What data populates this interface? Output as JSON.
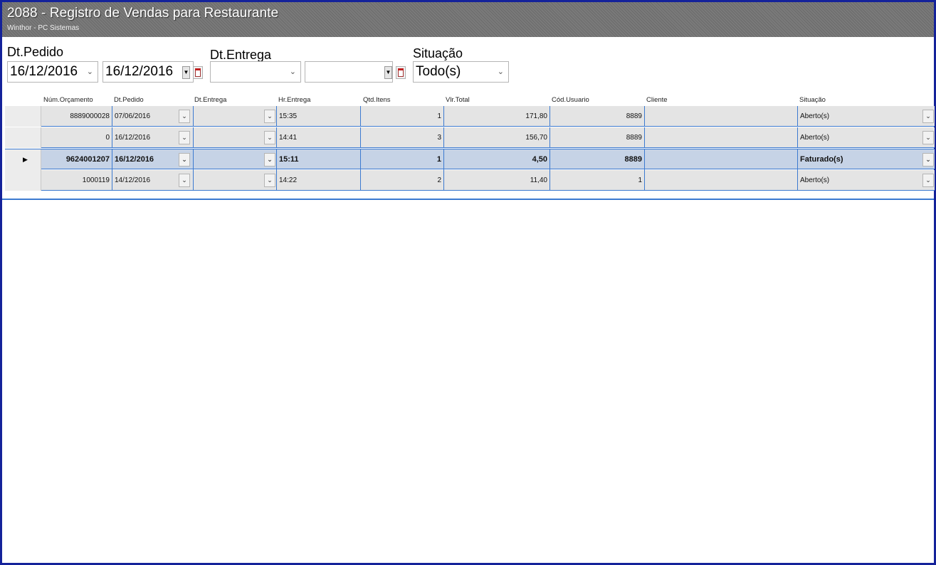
{
  "window": {
    "title": "2088 - Registro de Vendas para Restaurante",
    "subtitle": "Winthor - PC Sistemas"
  },
  "filters": {
    "dt_pedido_label": "Dt.Pedido",
    "dt_pedido_from": "16/12/2016",
    "dt_pedido_to": "16/12/2016",
    "dt_entrega_label": "Dt.Entrega",
    "dt_entrega_from": "",
    "dt_entrega_to": "",
    "situacao_label": "Situação",
    "situacao_value": "Todo(s)"
  },
  "grid": {
    "columns": [
      "Núm.Orçamento",
      "Dt.Pedido",
      "Dt.Entrega",
      "Hr.Entrega",
      "Qtd.Itens",
      "Vlr.Total",
      "Cód.Usuario",
      "Cliente",
      "Situação"
    ],
    "rows": [
      {
        "num": "8889000028",
        "dt_pedido": "07/06/2016",
        "dt_entrega": "",
        "hr_entrega": "15:35",
        "qtd": "1",
        "vlr": "171,80",
        "cod_usuario": "8889",
        "cliente": "",
        "situacao": "Aberto(s)",
        "selected": false
      },
      {
        "num": "0",
        "dt_pedido": "16/12/2016",
        "dt_entrega": "",
        "hr_entrega": "14:41",
        "qtd": "3",
        "vlr": "156,70",
        "cod_usuario": "8889",
        "cliente": "",
        "situacao": "Aberto(s)",
        "selected": false
      },
      {
        "num": "9624001207",
        "dt_pedido": "16/12/2016",
        "dt_entrega": "",
        "hr_entrega": "15:11",
        "qtd": "1",
        "vlr": "4,50",
        "cod_usuario": "8889",
        "cliente": "",
        "situacao": "Faturado(s)",
        "selected": true
      },
      {
        "num": "1000119",
        "dt_pedido": "14/12/2016",
        "dt_entrega": "",
        "hr_entrega": "14:22",
        "qtd": "2",
        "vlr": "11,40",
        "cod_usuario": "1",
        "cliente": "",
        "situacao": "Aberto(s)",
        "selected": false
      }
    ]
  },
  "colors": {
    "title_bar": "#6b6b6b",
    "window_border": "#14229a",
    "grid_line": "#3c7ad0",
    "row_selected": "#c6d3e6",
    "row_bg": "#e4e4e4"
  },
  "icons": {
    "dropdown": "chevron-down-icon",
    "calendar": "calendar-icon",
    "row_indicator": "triangle-right-icon"
  }
}
